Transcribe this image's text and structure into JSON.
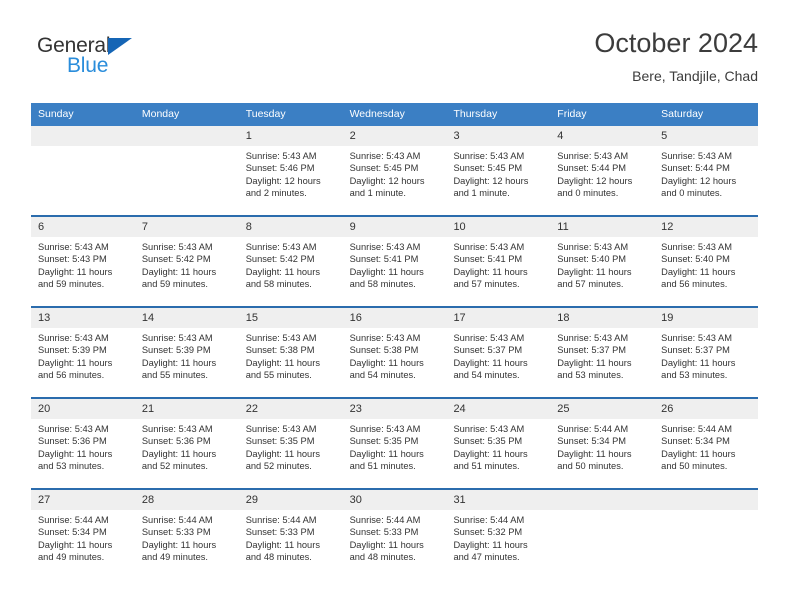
{
  "logo": {
    "word1": "General",
    "word2": "Blue",
    "triangle_color": "#1565b5",
    "word1_color": "#333333",
    "word2_color": "#2a8ddb"
  },
  "header": {
    "title": "October 2024",
    "subtitle": "Bere, Tandjile, Chad"
  },
  "colors": {
    "header_band": "#3b7fc4",
    "row_divider": "#2b6cad",
    "daynum_band": "#efefef",
    "text": "#333333"
  },
  "weekdays": [
    "Sunday",
    "Monday",
    "Tuesday",
    "Wednesday",
    "Thursday",
    "Friday",
    "Saturday"
  ],
  "weeks": [
    [
      {
        "day": ""
      },
      {
        "day": ""
      },
      {
        "day": "1",
        "sunrise": "Sunrise: 5:43 AM",
        "sunset": "Sunset: 5:46 PM",
        "daylight_line1": "Daylight: 12 hours",
        "daylight_line2": "and 2 minutes."
      },
      {
        "day": "2",
        "sunrise": "Sunrise: 5:43 AM",
        "sunset": "Sunset: 5:45 PM",
        "daylight_line1": "Daylight: 12 hours",
        "daylight_line2": "and 1 minute."
      },
      {
        "day": "3",
        "sunrise": "Sunrise: 5:43 AM",
        "sunset": "Sunset: 5:45 PM",
        "daylight_line1": "Daylight: 12 hours",
        "daylight_line2": "and 1 minute."
      },
      {
        "day": "4",
        "sunrise": "Sunrise: 5:43 AM",
        "sunset": "Sunset: 5:44 PM",
        "daylight_line1": "Daylight: 12 hours",
        "daylight_line2": "and 0 minutes."
      },
      {
        "day": "5",
        "sunrise": "Sunrise: 5:43 AM",
        "sunset": "Sunset: 5:44 PM",
        "daylight_line1": "Daylight: 12 hours",
        "daylight_line2": "and 0 minutes."
      }
    ],
    [
      {
        "day": "6",
        "sunrise": "Sunrise: 5:43 AM",
        "sunset": "Sunset: 5:43 PM",
        "daylight_line1": "Daylight: 11 hours",
        "daylight_line2": "and 59 minutes."
      },
      {
        "day": "7",
        "sunrise": "Sunrise: 5:43 AM",
        "sunset": "Sunset: 5:42 PM",
        "daylight_line1": "Daylight: 11 hours",
        "daylight_line2": "and 59 minutes."
      },
      {
        "day": "8",
        "sunrise": "Sunrise: 5:43 AM",
        "sunset": "Sunset: 5:42 PM",
        "daylight_line1": "Daylight: 11 hours",
        "daylight_line2": "and 58 minutes."
      },
      {
        "day": "9",
        "sunrise": "Sunrise: 5:43 AM",
        "sunset": "Sunset: 5:41 PM",
        "daylight_line1": "Daylight: 11 hours",
        "daylight_line2": "and 58 minutes."
      },
      {
        "day": "10",
        "sunrise": "Sunrise: 5:43 AM",
        "sunset": "Sunset: 5:41 PM",
        "daylight_line1": "Daylight: 11 hours",
        "daylight_line2": "and 57 minutes."
      },
      {
        "day": "11",
        "sunrise": "Sunrise: 5:43 AM",
        "sunset": "Sunset: 5:40 PM",
        "daylight_line1": "Daylight: 11 hours",
        "daylight_line2": "and 57 minutes."
      },
      {
        "day": "12",
        "sunrise": "Sunrise: 5:43 AM",
        "sunset": "Sunset: 5:40 PM",
        "daylight_line1": "Daylight: 11 hours",
        "daylight_line2": "and 56 minutes."
      }
    ],
    [
      {
        "day": "13",
        "sunrise": "Sunrise: 5:43 AM",
        "sunset": "Sunset: 5:39 PM",
        "daylight_line1": "Daylight: 11 hours",
        "daylight_line2": "and 56 minutes."
      },
      {
        "day": "14",
        "sunrise": "Sunrise: 5:43 AM",
        "sunset": "Sunset: 5:39 PM",
        "daylight_line1": "Daylight: 11 hours",
        "daylight_line2": "and 55 minutes."
      },
      {
        "day": "15",
        "sunrise": "Sunrise: 5:43 AM",
        "sunset": "Sunset: 5:38 PM",
        "daylight_line1": "Daylight: 11 hours",
        "daylight_line2": "and 55 minutes."
      },
      {
        "day": "16",
        "sunrise": "Sunrise: 5:43 AM",
        "sunset": "Sunset: 5:38 PM",
        "daylight_line1": "Daylight: 11 hours",
        "daylight_line2": "and 54 minutes."
      },
      {
        "day": "17",
        "sunrise": "Sunrise: 5:43 AM",
        "sunset": "Sunset: 5:37 PM",
        "daylight_line1": "Daylight: 11 hours",
        "daylight_line2": "and 54 minutes."
      },
      {
        "day": "18",
        "sunrise": "Sunrise: 5:43 AM",
        "sunset": "Sunset: 5:37 PM",
        "daylight_line1": "Daylight: 11 hours",
        "daylight_line2": "and 53 minutes."
      },
      {
        "day": "19",
        "sunrise": "Sunrise: 5:43 AM",
        "sunset": "Sunset: 5:37 PM",
        "daylight_line1": "Daylight: 11 hours",
        "daylight_line2": "and 53 minutes."
      }
    ],
    [
      {
        "day": "20",
        "sunrise": "Sunrise: 5:43 AM",
        "sunset": "Sunset: 5:36 PM",
        "daylight_line1": "Daylight: 11 hours",
        "daylight_line2": "and 53 minutes."
      },
      {
        "day": "21",
        "sunrise": "Sunrise: 5:43 AM",
        "sunset": "Sunset: 5:36 PM",
        "daylight_line1": "Daylight: 11 hours",
        "daylight_line2": "and 52 minutes."
      },
      {
        "day": "22",
        "sunrise": "Sunrise: 5:43 AM",
        "sunset": "Sunset: 5:35 PM",
        "daylight_line1": "Daylight: 11 hours",
        "daylight_line2": "and 52 minutes."
      },
      {
        "day": "23",
        "sunrise": "Sunrise: 5:43 AM",
        "sunset": "Sunset: 5:35 PM",
        "daylight_line1": "Daylight: 11 hours",
        "daylight_line2": "and 51 minutes."
      },
      {
        "day": "24",
        "sunrise": "Sunrise: 5:43 AM",
        "sunset": "Sunset: 5:35 PM",
        "daylight_line1": "Daylight: 11 hours",
        "daylight_line2": "and 51 minutes."
      },
      {
        "day": "25",
        "sunrise": "Sunrise: 5:44 AM",
        "sunset": "Sunset: 5:34 PM",
        "daylight_line1": "Daylight: 11 hours",
        "daylight_line2": "and 50 minutes."
      },
      {
        "day": "26",
        "sunrise": "Sunrise: 5:44 AM",
        "sunset": "Sunset: 5:34 PM",
        "daylight_line1": "Daylight: 11 hours",
        "daylight_line2": "and 50 minutes."
      }
    ],
    [
      {
        "day": "27",
        "sunrise": "Sunrise: 5:44 AM",
        "sunset": "Sunset: 5:34 PM",
        "daylight_line1": "Daylight: 11 hours",
        "daylight_line2": "and 49 minutes."
      },
      {
        "day": "28",
        "sunrise": "Sunrise: 5:44 AM",
        "sunset": "Sunset: 5:33 PM",
        "daylight_line1": "Daylight: 11 hours",
        "daylight_line2": "and 49 minutes."
      },
      {
        "day": "29",
        "sunrise": "Sunrise: 5:44 AM",
        "sunset": "Sunset: 5:33 PM",
        "daylight_line1": "Daylight: 11 hours",
        "daylight_line2": "and 48 minutes."
      },
      {
        "day": "30",
        "sunrise": "Sunrise: 5:44 AM",
        "sunset": "Sunset: 5:33 PM",
        "daylight_line1": "Daylight: 11 hours",
        "daylight_line2": "and 48 minutes."
      },
      {
        "day": "31",
        "sunrise": "Sunrise: 5:44 AM",
        "sunset": "Sunset: 5:32 PM",
        "daylight_line1": "Daylight: 11 hours",
        "daylight_line2": "and 47 minutes."
      },
      {
        "day": ""
      },
      {
        "day": ""
      }
    ]
  ]
}
